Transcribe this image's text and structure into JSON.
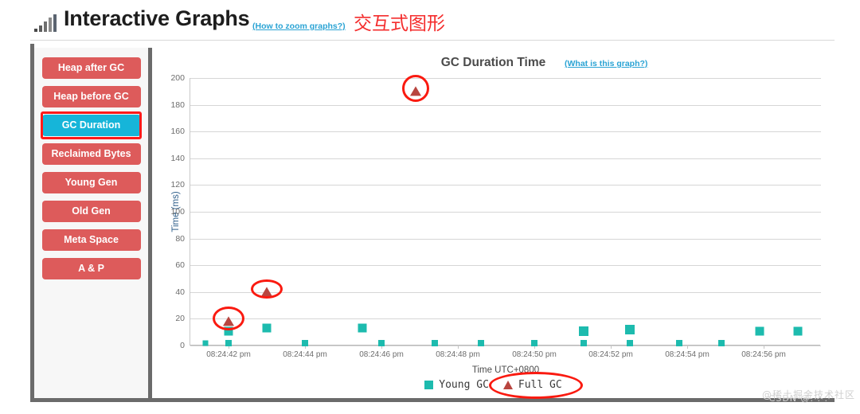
{
  "header": {
    "icon": "bar-chart-icon",
    "title": "Interactive Graphs",
    "help_link": "(How to zoom graphs?)",
    "cn_title": "交互式图形"
  },
  "sidebar": {
    "items": [
      {
        "label": "Heap after GC",
        "active": false
      },
      {
        "label": "Heap before GC",
        "active": false
      },
      {
        "label": "GC Duration",
        "active": true
      },
      {
        "label": "Reclaimed Bytes",
        "active": false
      },
      {
        "label": "Young Gen",
        "active": false
      },
      {
        "label": "Old Gen",
        "active": false
      },
      {
        "label": "Meta Space",
        "active": false
      },
      {
        "label": "A & P",
        "active": false
      }
    ],
    "selected_label": "GC Duration",
    "button_color": "#dd5b5b",
    "active_color": "#16b5d9",
    "highlight_color": "#ff1a1a"
  },
  "chart_panel": {
    "title": "GC Duration Time",
    "help_link": "(What is this graph?)"
  },
  "chart_data": {
    "type": "scatter",
    "title": "GC Duration Time",
    "xlabel": "Time UTC+0800",
    "ylabel": "Time (ms)",
    "ylim": [
      0,
      200
    ],
    "ytick_labels": [
      "0",
      "20",
      "40",
      "60",
      "80",
      "100",
      "120",
      "140",
      "160",
      "180",
      "200"
    ],
    "yticks": [
      0,
      20,
      40,
      60,
      80,
      100,
      120,
      140,
      160,
      180,
      200
    ],
    "xtick_labels": [
      "08:24:42 pm",
      "08:24:44 pm",
      "08:24:46 pm",
      "08:24:48 pm",
      "08:24:50 pm",
      "08:24:52 pm",
      "08:24:54 pm",
      "08:24:56 pm"
    ],
    "xlim": [
      41,
      57.5
    ],
    "grid": true,
    "legend_position": "bottom",
    "series": [
      {
        "name": "Young GC",
        "marker": "square",
        "color": "#1dbbae",
        "points": [
          {
            "x": 41.4,
            "y": 2,
            "size": 7
          },
          {
            "x": 42.0,
            "y": 2,
            "size": 8
          },
          {
            "x": 42.0,
            "y": 11,
            "size": 11
          },
          {
            "x": 43.0,
            "y": 13,
            "size": 11
          },
          {
            "x": 44.0,
            "y": 2,
            "size": 8
          },
          {
            "x": 45.5,
            "y": 13,
            "size": 11
          },
          {
            "x": 46.0,
            "y": 2,
            "size": 8
          },
          {
            "x": 47.4,
            "y": 2,
            "size": 8
          },
          {
            "x": 48.6,
            "y": 2,
            "size": 8
          },
          {
            "x": 50.0,
            "y": 2,
            "size": 8
          },
          {
            "x": 51.3,
            "y": 11,
            "size": 12
          },
          {
            "x": 51.3,
            "y": 2,
            "size": 8
          },
          {
            "x": 52.5,
            "y": 12,
            "size": 12
          },
          {
            "x": 52.5,
            "y": 2,
            "size": 8
          },
          {
            "x": 53.8,
            "y": 2,
            "size": 8
          },
          {
            "x": 54.9,
            "y": 2,
            "size": 8
          },
          {
            "x": 55.9,
            "y": 11,
            "size": 11
          },
          {
            "x": 56.9,
            "y": 11,
            "size": 11
          }
        ]
      },
      {
        "name": "Full GC",
        "marker": "triangle",
        "color": "#b8453f",
        "points": [
          {
            "x": 42.0,
            "y": 18
          },
          {
            "x": 43.0,
            "y": 40
          },
          {
            "x": 46.9,
            "y": 190
          }
        ]
      }
    ],
    "annotations": [
      {
        "type": "ellipse-highlight",
        "target": "full-gc-point-1",
        "x": 42.0,
        "y": 18,
        "color": "#fa1a10"
      },
      {
        "type": "ellipse-highlight",
        "target": "full-gc-point-2",
        "x": 43.0,
        "y": 40,
        "color": "#fa1a10"
      },
      {
        "type": "ellipse-highlight",
        "target": "full-gc-point-3",
        "x": 46.9,
        "y": 190,
        "color": "#fa1a10"
      },
      {
        "type": "ellipse-highlight",
        "target": "legend-full-gc",
        "color": "#fa1a10"
      }
    ]
  },
  "legend": {
    "entries": [
      {
        "label": "Young GC",
        "marker": "square",
        "color": "#1dbbae"
      },
      {
        "label": "Full  GC",
        "marker": "triangle",
        "color": "#b8453f"
      }
    ]
  },
  "watermark": {
    "primary": "@稀土掘金技术社区",
    "secondary": "CSDN @. . ."
  }
}
